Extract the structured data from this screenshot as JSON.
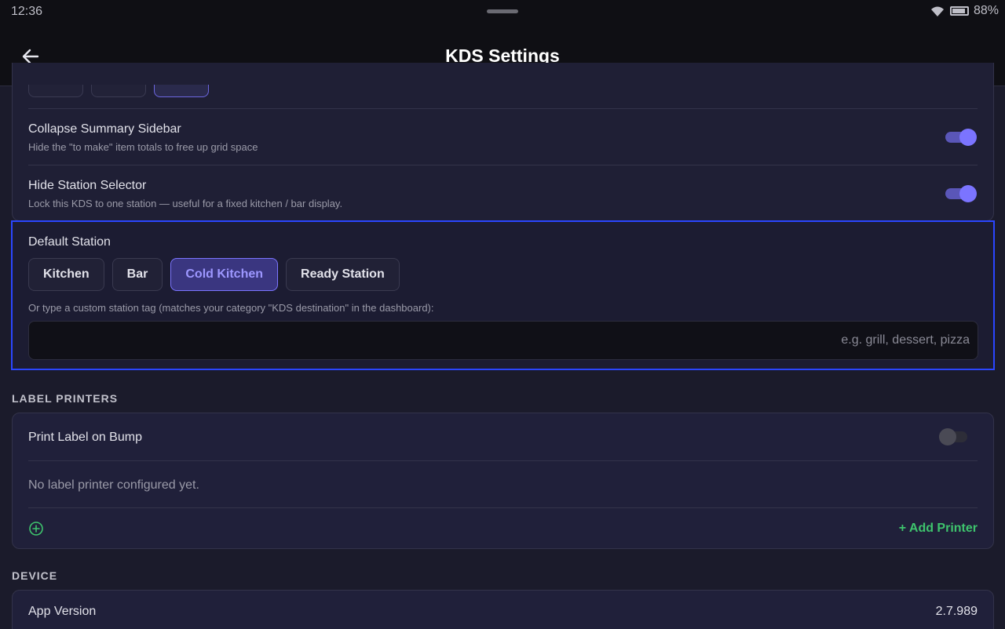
{
  "status_bar": {
    "time": "12:36",
    "battery": "88%"
  },
  "header": {
    "title": "KDS Settings"
  },
  "display": {
    "collapse_sidebar": {
      "title": "Collapse Summary Sidebar",
      "subtitle": "Hide the \"to make\" item totals to free up grid space",
      "enabled": true
    },
    "hide_station_selector": {
      "title": "Hide Station Selector",
      "subtitle": "Lock this KDS to one station — useful for a fixed kitchen / bar display.",
      "enabled": true
    }
  },
  "default_station": {
    "title": "Default Station",
    "options": [
      "Kitchen",
      "Bar",
      "Cold Kitchen",
      "Ready Station"
    ],
    "selected": "Cold Kitchen",
    "helper": "Or type a custom station tag (matches your category \"KDS destination\" in the dashboard):",
    "custom_value": "",
    "custom_placeholder": "e.g. grill, dessert, pizza"
  },
  "label_printers": {
    "section_title": "LABEL PRINTERS",
    "print_on_bump": {
      "title": "Print Label on Bump",
      "enabled": false
    },
    "empty_text": "No label printer configured yet.",
    "add_label": "+ Add Printer"
  },
  "device": {
    "section_title": "DEVICE",
    "app_version_label": "App Version",
    "app_version": "2.7.989"
  },
  "colors": {
    "accent": "#7b74ff",
    "success": "#3ec46d",
    "highlight": "#2b46ff",
    "background": "#1b1b2b"
  }
}
